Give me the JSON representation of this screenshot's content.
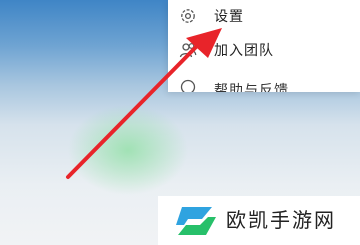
{
  "menu": {
    "items": [
      {
        "label": "设置",
        "icon": "gear-icon"
      },
      {
        "label": "加入团队",
        "icon": "people-icon"
      },
      {
        "label": "帮助与反馈",
        "icon": "help-icon"
      }
    ]
  },
  "annotation": {
    "color": "#e8242a",
    "target": "设置"
  },
  "watermark": {
    "text": "欧凯手游网",
    "colors": [
      "#2fa3e0",
      "#27c06a"
    ]
  }
}
